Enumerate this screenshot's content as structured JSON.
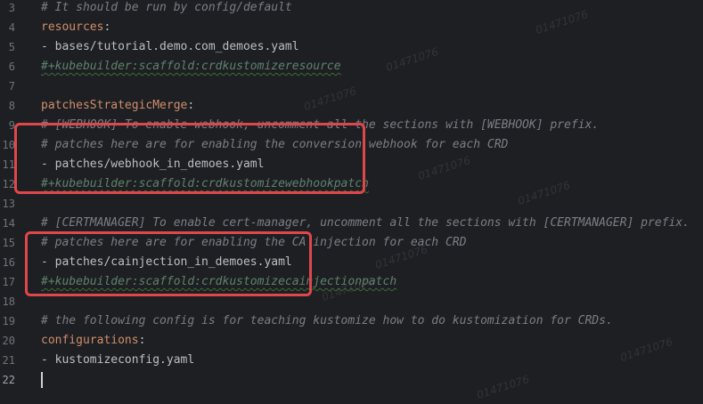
{
  "editor": {
    "watermark_text": "01471076",
    "active_line": 22,
    "highlight_color": "#e0474c",
    "lines": [
      {
        "num": "3",
        "parts": [
          {
            "t": "# It should be run by config/default",
            "c": "c-comment"
          }
        ]
      },
      {
        "num": "4",
        "parts": [
          {
            "t": "resources",
            "c": "c-key"
          },
          {
            "t": ":",
            "c": "c-plain"
          }
        ]
      },
      {
        "num": "5",
        "parts": [
          {
            "t": "- bases/tutorial.demo.com_demoes.yaml",
            "c": "c-plain"
          }
        ]
      },
      {
        "num": "6",
        "parts": [
          {
            "t": "#+kubebuilder:scaffold:crdkustomizeresource",
            "c": "c-comment-green squig"
          }
        ]
      },
      {
        "num": "7",
        "parts": []
      },
      {
        "num": "8",
        "parts": [
          {
            "t": "patchesStrategicMerge",
            "c": "c-key"
          },
          {
            "t": ":",
            "c": "c-plain"
          }
        ]
      },
      {
        "num": "9",
        "parts": [
          {
            "t": "# [WEBHOOK] To enable webhook, uncomment all the sections with [WEBHOOK] prefix.",
            "c": "c-comment"
          }
        ]
      },
      {
        "num": "10",
        "parts": [
          {
            "t": "# patches here are for enabling the conversion webhook for each CRD",
            "c": "c-comment"
          }
        ]
      },
      {
        "num": "11",
        "parts": [
          {
            "t": "- patches/webhook_in_demoes.yaml",
            "c": "c-plain"
          }
        ]
      },
      {
        "num": "12",
        "parts": [
          {
            "t": "#+kubebuilder:scaffold:crdkustomizewebhookpatch",
            "c": "c-comment-green squig"
          }
        ]
      },
      {
        "num": "13",
        "parts": []
      },
      {
        "num": "14",
        "parts": [
          {
            "t": "# [CERTMANAGER] To enable cert-manager, uncomment all the sections with [CERTMANAGER] prefix.",
            "c": "c-comment"
          }
        ]
      },
      {
        "num": "15",
        "parts": [
          {
            "t": "# patches here are for enabling the CA injection for each CRD",
            "c": "c-comment"
          }
        ]
      },
      {
        "num": "16",
        "parts": [
          {
            "t": "- patches/cainjection_in_demoes.yaml",
            "c": "c-plain"
          }
        ]
      },
      {
        "num": "17",
        "parts": [
          {
            "t": "#+kubebuilder:scaffold:crdkustomizecainjectionpatch",
            "c": "c-comment-green squig"
          }
        ]
      },
      {
        "num": "18",
        "parts": []
      },
      {
        "num": "19",
        "parts": [
          {
            "t": "# the following config is for teaching kustomize how to do kustomization for CRDs.",
            "c": "c-comment"
          }
        ]
      },
      {
        "num": "20",
        "parts": [
          {
            "t": "configurations",
            "c": "c-key"
          },
          {
            "t": ":",
            "c": "c-plain"
          }
        ]
      },
      {
        "num": "21",
        "parts": [
          {
            "t": "- kustomizeconfig.yaml",
            "c": "c-plain"
          }
        ]
      },
      {
        "num": "22",
        "parts": []
      }
    ]
  }
}
